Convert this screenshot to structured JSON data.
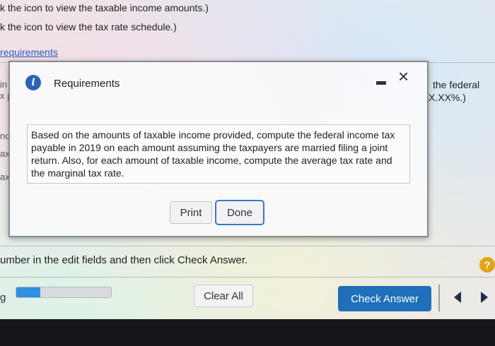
{
  "instructions": {
    "line1": "k the icon to view the taxable income amounts.)",
    "line2": "k the icon to view the tax rate schedule.)",
    "requirements_link": "requirements"
  },
  "background_fragments": {
    "left1": "in",
    "left2": "x p",
    "left3": "nco",
    "left4": "ax",
    "left5": "ax",
    "right1": "the federal",
    "right2": "X.XX%.)",
    "bottom_left": "g"
  },
  "modal": {
    "title": "Requirements",
    "info_icon": "i",
    "minimize_icon": "minimize-icon",
    "close_icon": "×",
    "requirement_text": "Based on the amounts of taxable income provided, compute the federal income tax payable in 2019 on each amount assuming the taxpayers are married filing a joint return. Also, for each amount of taxable income, compute the average tax rate and the marginal tax rate.",
    "print_label": "Print",
    "done_label": "Done"
  },
  "footer": {
    "instruction": "umber in the edit fields and then click Check Answer.",
    "help_label": "?",
    "progress_fraction": 0.25,
    "clear_all_label": "Clear All",
    "check_answer_label": "Check Answer",
    "prev_icon": "prev-arrow-icon",
    "next_icon": "next-arrow-icon"
  },
  "colors": {
    "link": "#2a5bb8",
    "info_icon": "#2a63b3",
    "done_border": "#3b77c4",
    "check_answer_bg": "#1f6fba",
    "help_icon": "#e2a419",
    "progress_fill": "#2f8fe0"
  }
}
